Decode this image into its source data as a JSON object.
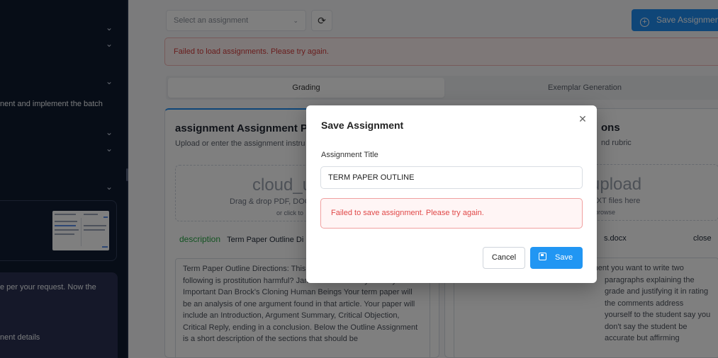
{
  "sidebar": {
    "texts": {
      "line1": "nent and implement the batch",
      "line2": "e per your request. Now the",
      "line3": "nent details"
    },
    "chevron_icon": "chevron-down-icon"
  },
  "toolbar": {
    "select_placeholder": "Select an assignment",
    "refresh_icon": "refresh-icon",
    "save_label": "Save Assignment"
  },
  "error_banner": "Failed to load assignments. Please try again.",
  "tabs": [
    {
      "label": "Grading",
      "active": true
    },
    {
      "label": "Exemplar Generation",
      "active": false
    }
  ],
  "left_panel": {
    "title": "assignment  Assignment P",
    "subtitle": "Upload or enter the assignment instru",
    "drop_big": "cloud_u",
    "drop_small": "Drag & drop PDF, DOC",
    "drop_tiny": "or click to",
    "file_icon": "description",
    "file_name": "Term Paper Outline Di",
    "text": "Term Paper Outline Directions: This term paper on one of the following is prostitution harmful? James Rachels' Why Privacy is Important Dan Brock's Cloning Human Beings Your term paper will be an analysis of one argument found in that article. Your paper will include an Introduction, Argument Summary, Critical Objection, Critical Reply, ending in a conclusion. Below the Outline Assignment is a short description of the sections that should be"
  },
  "right_panel": {
    "title": "ons",
    "subtitle": "nd rubric",
    "drop_big": "upload",
    "drop_small": "X, or TXT files here",
    "drop_tiny": "browse",
    "file_name": "s.docx",
    "close_label": "close",
    "text": "ssignments at the grade is out assignment you want to write two paragraphs explaining the grade and justifying it in rating the comments address yourself to the student say you don't say the student be accurate but affirming"
  },
  "modal": {
    "title": "Save Assignment",
    "close_icon": "close-icon",
    "field_label": "Assignment Title",
    "field_value": "TERM PAPER OUTLINE",
    "error": "Failed to save assignment. Please try again.",
    "cancel_label": "Cancel",
    "save_label": "Save",
    "save_icon": "save-icon"
  },
  "colors": {
    "accent": "#2196f3",
    "error": "#e04848",
    "sidebar": "#0f1a2e"
  }
}
